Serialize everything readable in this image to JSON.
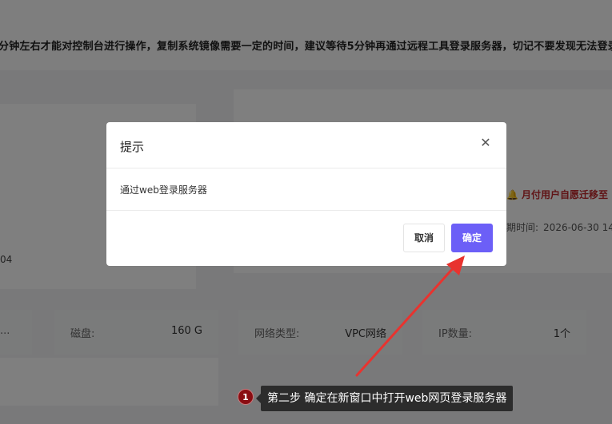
{
  "page": {
    "notice": "分钟左右才能对控制台进行操作，复制系统镜像需要一定的时间，建议等待5分钟再通过远程工具登录服务器，切记不要发现无法登录就",
    "os_fragment": "04",
    "migrate_text": "月付用户自愿迁移至",
    "migrate_icon": "bell-icon",
    "expire_label": "期时间:",
    "expire_value": "2026-06-30 14",
    "stats": [
      {
        "label": "",
        "value": "..."
      },
      {
        "label": "磁盘:",
        "value": "160 G"
      },
      {
        "label": "网络类型:",
        "value": "VPC网络"
      },
      {
        "label": "IP数量:",
        "value": "1个"
      }
    ]
  },
  "dialog": {
    "title": "提示",
    "close_icon": "close-icon",
    "message": "通过web登录服务器",
    "cancel_label": "取消",
    "confirm_label": "确定"
  },
  "annotation": {
    "step_number": "1",
    "tooltip": "第二步 确定在新窗口中打开web网页登录服务器",
    "arrow_color": "#e8332f"
  }
}
